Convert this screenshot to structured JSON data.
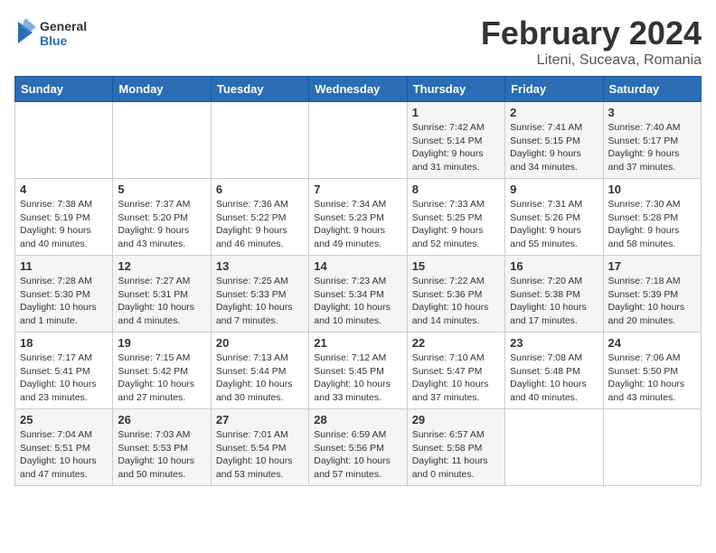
{
  "header": {
    "logo_general": "General",
    "logo_blue": "Blue",
    "month_year": "February 2024",
    "location": "Liteni, Suceava, Romania"
  },
  "days_of_week": [
    "Sunday",
    "Monday",
    "Tuesday",
    "Wednesday",
    "Thursday",
    "Friday",
    "Saturday"
  ],
  "weeks": [
    {
      "days": [
        {
          "number": "",
          "info": ""
        },
        {
          "number": "",
          "info": ""
        },
        {
          "number": "",
          "info": ""
        },
        {
          "number": "",
          "info": ""
        },
        {
          "number": "1",
          "info": "Sunrise: 7:42 AM\nSunset: 5:14 PM\nDaylight: 9 hours\nand 31 minutes."
        },
        {
          "number": "2",
          "info": "Sunrise: 7:41 AM\nSunset: 5:15 PM\nDaylight: 9 hours\nand 34 minutes."
        },
        {
          "number": "3",
          "info": "Sunrise: 7:40 AM\nSunset: 5:17 PM\nDaylight: 9 hours\nand 37 minutes."
        }
      ]
    },
    {
      "days": [
        {
          "number": "4",
          "info": "Sunrise: 7:38 AM\nSunset: 5:19 PM\nDaylight: 9 hours\nand 40 minutes."
        },
        {
          "number": "5",
          "info": "Sunrise: 7:37 AM\nSunset: 5:20 PM\nDaylight: 9 hours\nand 43 minutes."
        },
        {
          "number": "6",
          "info": "Sunrise: 7:36 AM\nSunset: 5:22 PM\nDaylight: 9 hours\nand 46 minutes."
        },
        {
          "number": "7",
          "info": "Sunrise: 7:34 AM\nSunset: 5:23 PM\nDaylight: 9 hours\nand 49 minutes."
        },
        {
          "number": "8",
          "info": "Sunrise: 7:33 AM\nSunset: 5:25 PM\nDaylight: 9 hours\nand 52 minutes."
        },
        {
          "number": "9",
          "info": "Sunrise: 7:31 AM\nSunset: 5:26 PM\nDaylight: 9 hours\nand 55 minutes."
        },
        {
          "number": "10",
          "info": "Sunrise: 7:30 AM\nSunset: 5:28 PM\nDaylight: 9 hours\nand 58 minutes."
        }
      ]
    },
    {
      "days": [
        {
          "number": "11",
          "info": "Sunrise: 7:28 AM\nSunset: 5:30 PM\nDaylight: 10 hours\nand 1 minute."
        },
        {
          "number": "12",
          "info": "Sunrise: 7:27 AM\nSunset: 5:31 PM\nDaylight: 10 hours\nand 4 minutes."
        },
        {
          "number": "13",
          "info": "Sunrise: 7:25 AM\nSunset: 5:33 PM\nDaylight: 10 hours\nand 7 minutes."
        },
        {
          "number": "14",
          "info": "Sunrise: 7:23 AM\nSunset: 5:34 PM\nDaylight: 10 hours\nand 10 minutes."
        },
        {
          "number": "15",
          "info": "Sunrise: 7:22 AM\nSunset: 5:36 PM\nDaylight: 10 hours\nand 14 minutes."
        },
        {
          "number": "16",
          "info": "Sunrise: 7:20 AM\nSunset: 5:38 PM\nDaylight: 10 hours\nand 17 minutes."
        },
        {
          "number": "17",
          "info": "Sunrise: 7:18 AM\nSunset: 5:39 PM\nDaylight: 10 hours\nand 20 minutes."
        }
      ]
    },
    {
      "days": [
        {
          "number": "18",
          "info": "Sunrise: 7:17 AM\nSunset: 5:41 PM\nDaylight: 10 hours\nand 23 minutes."
        },
        {
          "number": "19",
          "info": "Sunrise: 7:15 AM\nSunset: 5:42 PM\nDaylight: 10 hours\nand 27 minutes."
        },
        {
          "number": "20",
          "info": "Sunrise: 7:13 AM\nSunset: 5:44 PM\nDaylight: 10 hours\nand 30 minutes."
        },
        {
          "number": "21",
          "info": "Sunrise: 7:12 AM\nSunset: 5:45 PM\nDaylight: 10 hours\nand 33 minutes."
        },
        {
          "number": "22",
          "info": "Sunrise: 7:10 AM\nSunset: 5:47 PM\nDaylight: 10 hours\nand 37 minutes."
        },
        {
          "number": "23",
          "info": "Sunrise: 7:08 AM\nSunset: 5:48 PM\nDaylight: 10 hours\nand 40 minutes."
        },
        {
          "number": "24",
          "info": "Sunrise: 7:06 AM\nSunset: 5:50 PM\nDaylight: 10 hours\nand 43 minutes."
        }
      ]
    },
    {
      "days": [
        {
          "number": "25",
          "info": "Sunrise: 7:04 AM\nSunset: 5:51 PM\nDaylight: 10 hours\nand 47 minutes."
        },
        {
          "number": "26",
          "info": "Sunrise: 7:03 AM\nSunset: 5:53 PM\nDaylight: 10 hours\nand 50 minutes."
        },
        {
          "number": "27",
          "info": "Sunrise: 7:01 AM\nSunset: 5:54 PM\nDaylight: 10 hours\nand 53 minutes."
        },
        {
          "number": "28",
          "info": "Sunrise: 6:59 AM\nSunset: 5:56 PM\nDaylight: 10 hours\nand 57 minutes."
        },
        {
          "number": "29",
          "info": "Sunrise: 6:57 AM\nSunset: 5:58 PM\nDaylight: 11 hours\nand 0 minutes."
        },
        {
          "number": "",
          "info": ""
        },
        {
          "number": "",
          "info": ""
        }
      ]
    }
  ]
}
